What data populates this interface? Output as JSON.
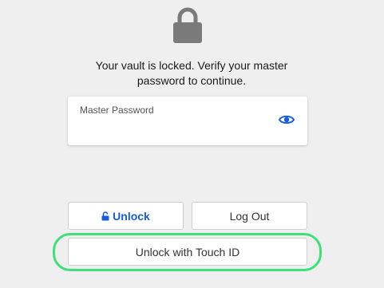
{
  "header": {
    "icon": "lock-icon",
    "message_line1": "Your vault is locked. Verify your master",
    "message_line2": "password to continue."
  },
  "password_field": {
    "label": "Master Password",
    "value": "",
    "toggle_icon": "eye-icon"
  },
  "actions": {
    "unlock_label": "Unlock",
    "unlock_icon": "unlock-icon",
    "logout_label": "Log Out",
    "touchid_label": "Unlock with Touch ID"
  },
  "colors": {
    "accent": "#175ddc",
    "highlight": "#3ee07a",
    "background": "#efefef"
  }
}
